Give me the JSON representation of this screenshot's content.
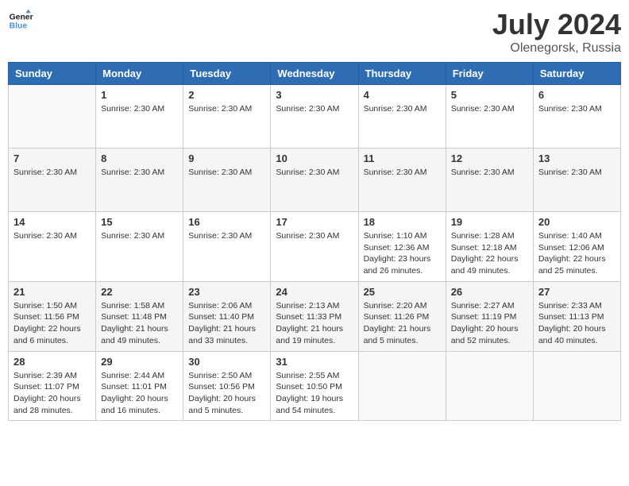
{
  "header": {
    "logo_line1": "General",
    "logo_line2": "Blue",
    "title": "July 2024",
    "subtitle": "Olenegorsk, Russia"
  },
  "columns": [
    "Sunday",
    "Monday",
    "Tuesday",
    "Wednesday",
    "Thursday",
    "Friday",
    "Saturday"
  ],
  "weeks": [
    {
      "days": [
        {
          "num": "",
          "info": "",
          "empty": true
        },
        {
          "num": "1",
          "info": "Sunrise: 2:30 AM",
          "empty": false
        },
        {
          "num": "2",
          "info": "Sunrise: 2:30 AM",
          "empty": false
        },
        {
          "num": "3",
          "info": "Sunrise: 2:30 AM",
          "empty": false
        },
        {
          "num": "4",
          "info": "Sunrise: 2:30 AM",
          "empty": false
        },
        {
          "num": "5",
          "info": "Sunrise: 2:30 AM",
          "empty": false
        },
        {
          "num": "6",
          "info": "Sunrise: 2:30 AM",
          "empty": false
        }
      ]
    },
    {
      "days": [
        {
          "num": "7",
          "info": "Sunrise: 2:30 AM",
          "empty": false
        },
        {
          "num": "8",
          "info": "Sunrise: 2:30 AM",
          "empty": false
        },
        {
          "num": "9",
          "info": "Sunrise: 2:30 AM",
          "empty": false
        },
        {
          "num": "10",
          "info": "Sunrise: 2:30 AM",
          "empty": false
        },
        {
          "num": "11",
          "info": "Sunrise: 2:30 AM",
          "empty": false
        },
        {
          "num": "12",
          "info": "Sunrise: 2:30 AM",
          "empty": false
        },
        {
          "num": "13",
          "info": "Sunrise: 2:30 AM",
          "empty": false
        }
      ]
    },
    {
      "days": [
        {
          "num": "14",
          "info": "Sunrise: 2:30 AM",
          "empty": false
        },
        {
          "num": "15",
          "info": "Sunrise: 2:30 AM",
          "empty": false
        },
        {
          "num": "16",
          "info": "Sunrise: 2:30 AM",
          "empty": false
        },
        {
          "num": "17",
          "info": "Sunrise: 2:30 AM",
          "empty": false
        },
        {
          "num": "18",
          "info": "Sunrise: 1:10 AM\nSunset: 12:36 AM\nDaylight: 23 hours and 26 minutes.",
          "empty": false
        },
        {
          "num": "19",
          "info": "Sunrise: 1:28 AM\nSunset: 12:18 AM\nDaylight: 22 hours and 49 minutes.",
          "empty": false
        },
        {
          "num": "20",
          "info": "Sunrise: 1:40 AM\nSunset: 12:06 AM\nDaylight: 22 hours and 25 minutes.",
          "empty": false
        }
      ]
    },
    {
      "days": [
        {
          "num": "21",
          "info": "Sunrise: 1:50 AM\nSunset: 11:56 PM\nDaylight: 22 hours and 6 minutes.",
          "empty": false
        },
        {
          "num": "22",
          "info": "Sunrise: 1:58 AM\nSunset: 11:48 PM\nDaylight: 21 hours and 49 minutes.",
          "empty": false
        },
        {
          "num": "23",
          "info": "Sunrise: 2:06 AM\nSunset: 11:40 PM\nDaylight: 21 hours and 33 minutes.",
          "empty": false
        },
        {
          "num": "24",
          "info": "Sunrise: 2:13 AM\nSunset: 11:33 PM\nDaylight: 21 hours and 19 minutes.",
          "empty": false
        },
        {
          "num": "25",
          "info": "Sunrise: 2:20 AM\nSunset: 11:26 PM\nDaylight: 21 hours and 5 minutes.",
          "empty": false
        },
        {
          "num": "26",
          "info": "Sunrise: 2:27 AM\nSunset: 11:19 PM\nDaylight: 20 hours and 52 minutes.",
          "empty": false
        },
        {
          "num": "27",
          "info": "Sunrise: 2:33 AM\nSunset: 11:13 PM\nDaylight: 20 hours and 40 minutes.",
          "empty": false
        }
      ]
    },
    {
      "days": [
        {
          "num": "28",
          "info": "Sunrise: 2:39 AM\nSunset: 11:07 PM\nDaylight: 20 hours and 28 minutes.",
          "empty": false
        },
        {
          "num": "29",
          "info": "Sunrise: 2:44 AM\nSunset: 11:01 PM\nDaylight: 20 hours and 16 minutes.",
          "empty": false
        },
        {
          "num": "30",
          "info": "Sunrise: 2:50 AM\nSunset: 10:56 PM\nDaylight: 20 hours and 5 minutes.",
          "empty": false
        },
        {
          "num": "31",
          "info": "Sunrise: 2:55 AM\nSunset: 10:50 PM\nDaylight: 19 hours and 54 minutes.",
          "empty": false
        },
        {
          "num": "",
          "info": "",
          "empty": true
        },
        {
          "num": "",
          "info": "",
          "empty": true
        },
        {
          "num": "",
          "info": "",
          "empty": true
        }
      ]
    }
  ]
}
